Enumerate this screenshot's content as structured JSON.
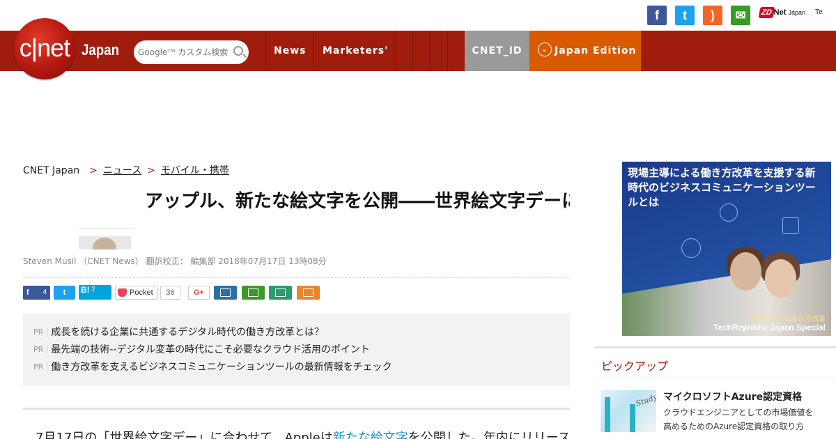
{
  "social": {
    "facebook_glyph": "f",
    "twitter_glyph": "t",
    "rss_glyph": ")",
    "mail_glyph": "✉"
  },
  "zdnet": {
    "badge": "ZD",
    "name": "Net",
    "suffix": "Japan"
  },
  "techrepublic": {
    "text": "Te"
  },
  "header": {
    "logo": "c|net",
    "logo_suffix": "Japan",
    "search_placeholder": "Googleᵀᴹ カスタム検索",
    "nav": [
      "News",
      "Marketers'",
      "",
      "",
      ""
    ],
    "cnet_id": "CNET_ID",
    "edition": "Japan Edition"
  },
  "breadcrumb": {
    "home": "CNET Japan",
    "level1": "ニュース",
    "level2": "モバイル・携帯"
  },
  "article": {
    "title": "アップル、新たな絵文字を公開――世界絵文字デーに合わせて新作",
    "author": "Steven Musil （CNET News） 翻訳校正： 編集部 2018年07月17日 13時08分",
    "share": {
      "facebook_count": "4",
      "hatena_glyph": "B!",
      "hatena_count": "2",
      "pocket_label": "Pocket",
      "pocket_count": "36",
      "gplus": "G+"
    },
    "pr": [
      {
        "tag": "PR",
        "text": "成長を続ける企業に共通するデジタル時代の働き方改革とは？"
      },
      {
        "tag": "PR",
        "text": "最先端の技術--デジタル変革の時代にこそ必要なクラウド活用のポイント"
      },
      {
        "tag": "PR",
        "text": "働き方改革を支えるビジネスコミュニケーションツールの最新情報をチェック"
      }
    ],
    "lead_before": "　7月17日の「世界絵文字デー」に合わせて、Appleは",
    "lead_link": "新たな絵文字",
    "lead_after": "を公開した。年内にリリースされる予定。"
  },
  "ad": {
    "headline": "現場主導による働き方改革を支援する新時代のビジネスコミュニケーションツールとは",
    "sub1": "明日をつくる働き方改革",
    "sub2": "TechRepublic Japan Special"
  },
  "sidebar": {
    "heading": "ピックアップ",
    "item": {
      "title": "マイクロソフトAzure認定資格",
      "desc1": "クラウドエンジニアとしての市場価値を",
      "desc2": "高めるためのAzure認定資格の取り方"
    }
  },
  "colors": {
    "brand_red": "#a01d0e",
    "edition_orange": "#d95a00",
    "cnet_id_gray": "#9a9a9a",
    "link_blue": "#1a8fc4"
  }
}
